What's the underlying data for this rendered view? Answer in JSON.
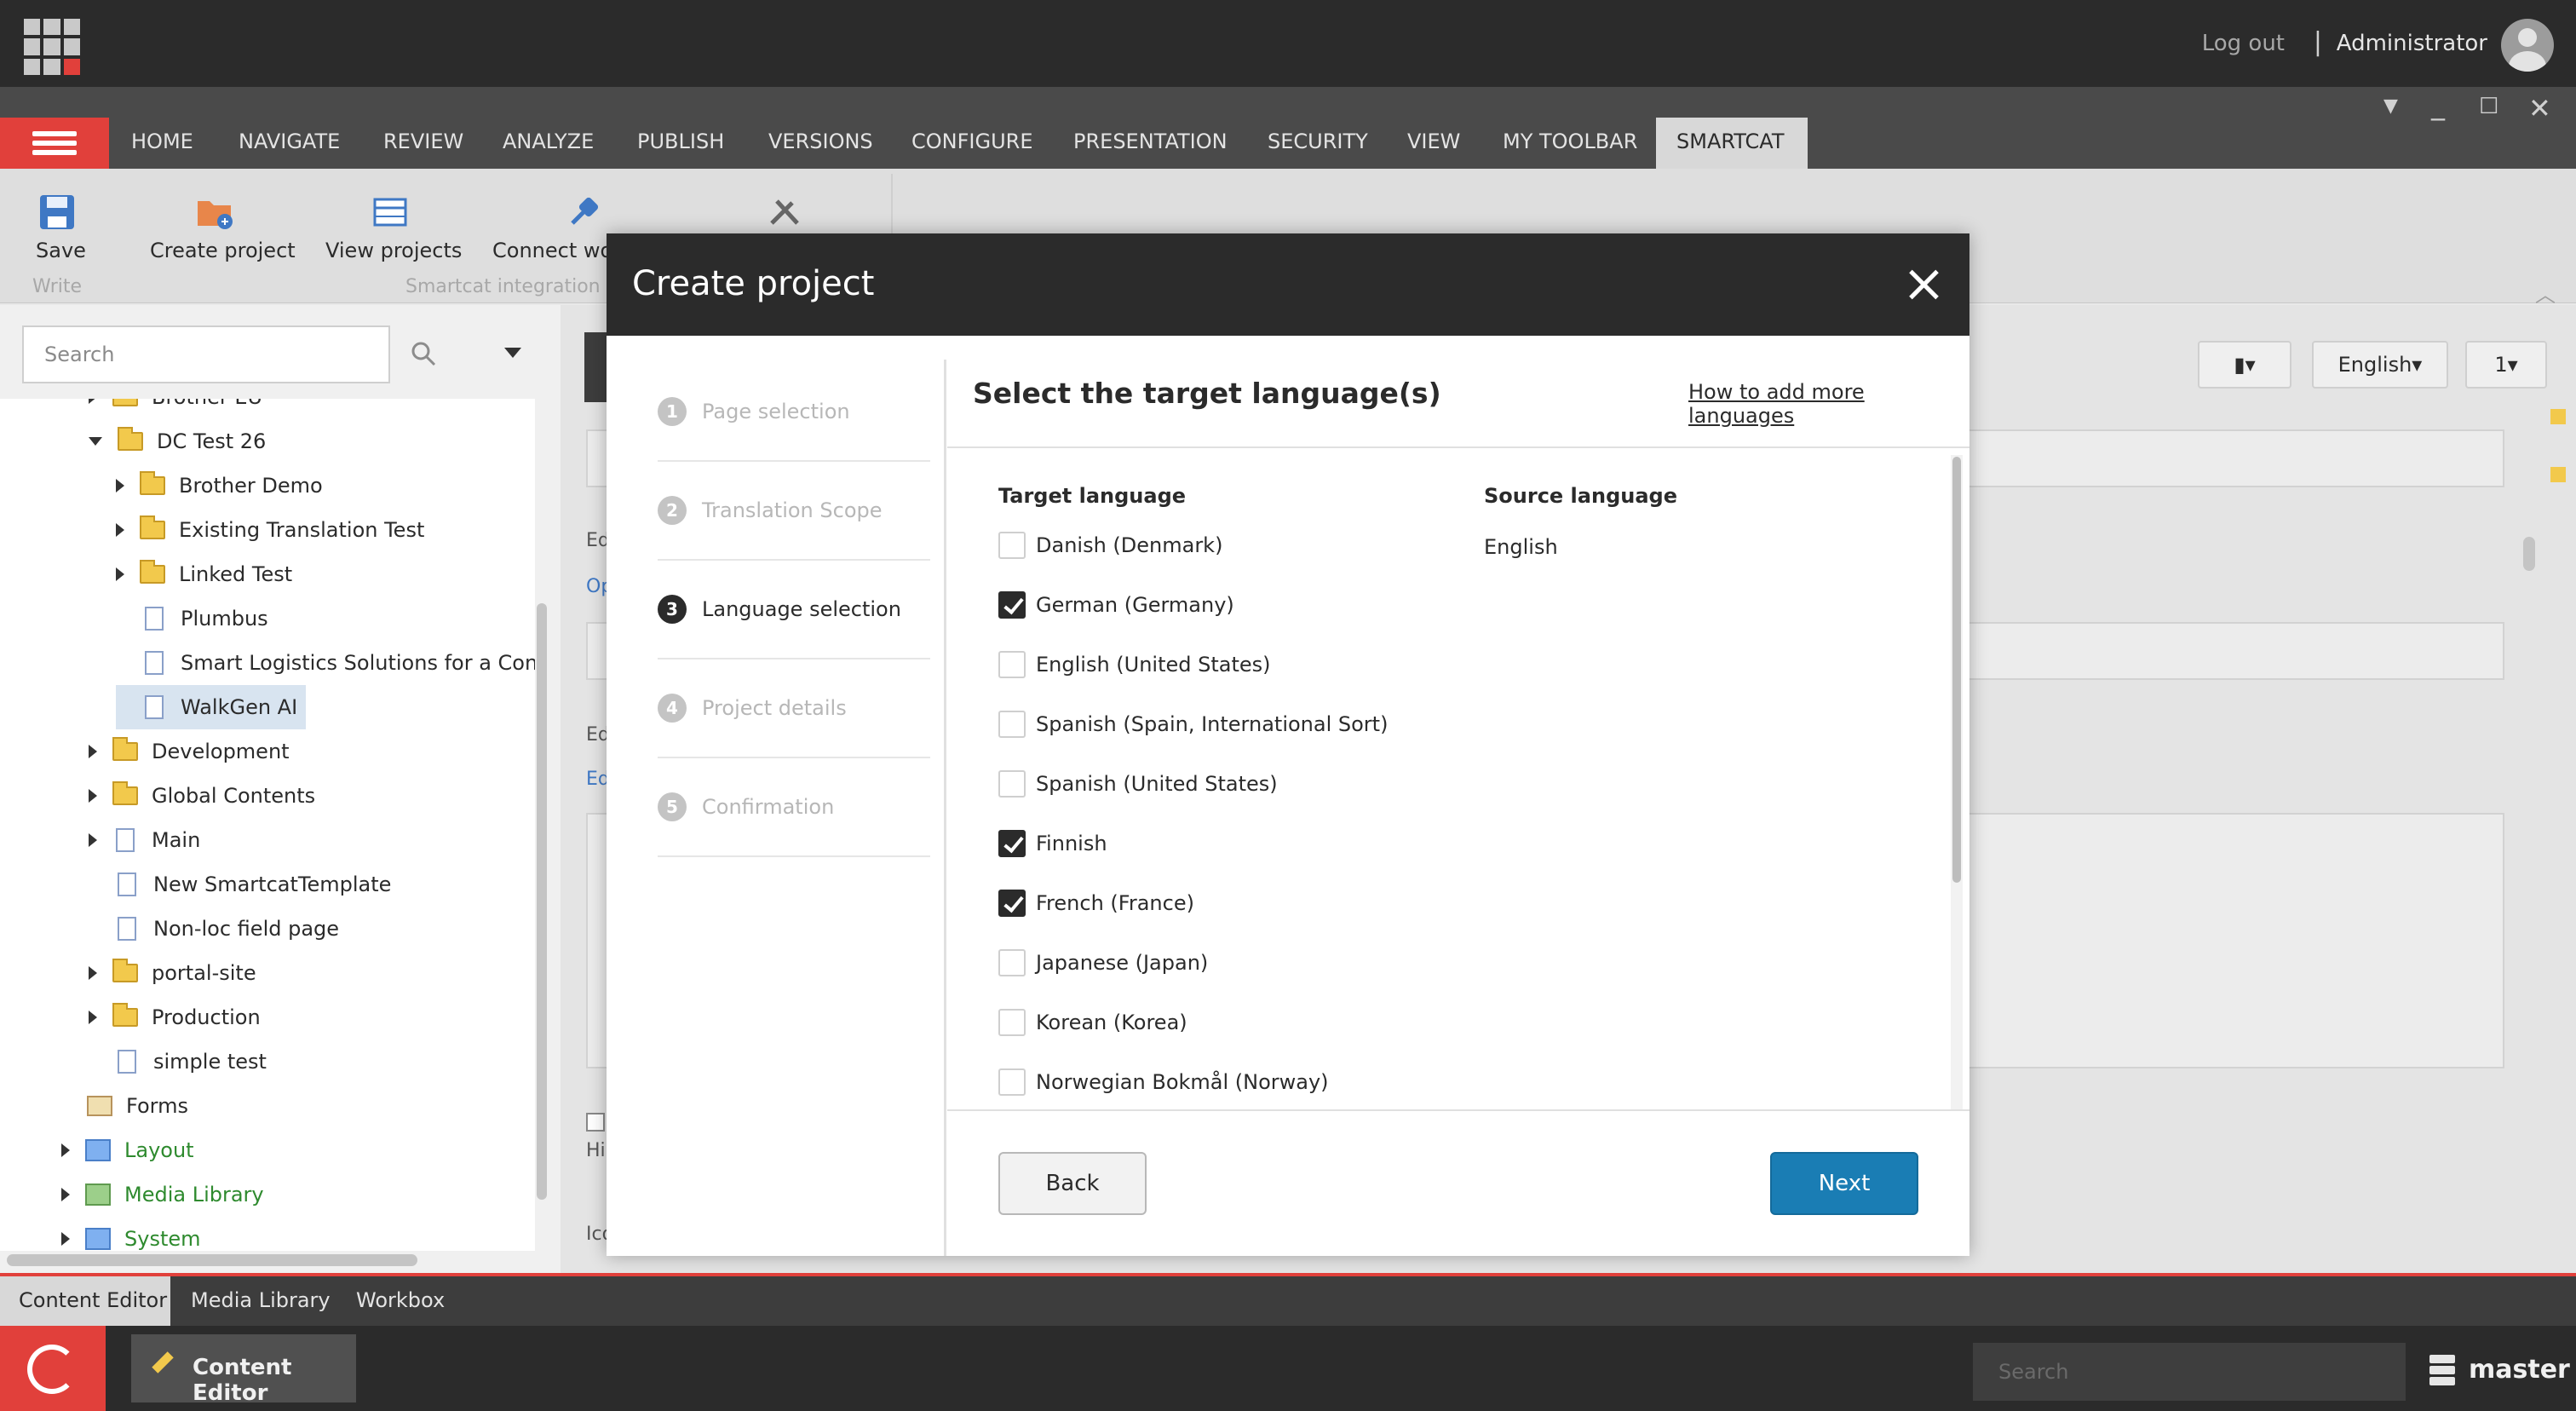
{
  "topbar": {
    "logout": "Log out",
    "separator": "|",
    "user": "Administrator"
  },
  "ribbon_tabs": [
    "HOME",
    "NAVIGATE",
    "REVIEW",
    "ANALYZE",
    "PUBLISH",
    "VERSIONS",
    "CONFIGURE",
    "PRESENTATION",
    "SECURITY",
    "VIEW",
    "MY TOOLBAR",
    "SMARTCAT"
  ],
  "active_tab": "SMARTCAT",
  "ribbon": {
    "save": "Save",
    "create_project": "Create project",
    "view_projects": "View projects",
    "connect": "Connect wo",
    "group_write": "Write",
    "group_smartcat": "Smartcat integration"
  },
  "search": {
    "placeholder": "Search"
  },
  "tree": [
    {
      "label": "Brother EU",
      "indent": 1,
      "arrow": "r",
      "icon": "folder"
    },
    {
      "label": "DC Test 26",
      "indent": 1,
      "arrow": "d",
      "icon": "folder"
    },
    {
      "label": "Brother Demo",
      "indent": 2,
      "arrow": "r",
      "icon": "folder"
    },
    {
      "label": "Existing Translation Test",
      "indent": 2,
      "arrow": "r",
      "icon": "folder"
    },
    {
      "label": "Linked Test",
      "indent": 2,
      "arrow": "r",
      "icon": "folder"
    },
    {
      "label": "Plumbus",
      "indent": 2,
      "arrow": "",
      "icon": "doc"
    },
    {
      "label": "Smart Logistics Solutions for a Con",
      "indent": 2,
      "arrow": "",
      "icon": "doc"
    },
    {
      "label": "WalkGen AI",
      "indent": 2,
      "arrow": "",
      "icon": "doc",
      "selected": true
    },
    {
      "label": "Development",
      "indent": 1,
      "arrow": "r",
      "icon": "folder"
    },
    {
      "label": "Global Contents",
      "indent": 1,
      "arrow": "r",
      "icon": "folder"
    },
    {
      "label": "Main",
      "indent": 1,
      "arrow": "r",
      "icon": "doc"
    },
    {
      "label": "New SmartcatTemplate",
      "indent": 1,
      "arrow": "",
      "icon": "doc"
    },
    {
      "label": "Non-loc field page",
      "indent": 1,
      "arrow": "",
      "icon": "doc"
    },
    {
      "label": "portal-site",
      "indent": 1,
      "arrow": "r",
      "icon": "folder"
    },
    {
      "label": "Production",
      "indent": 1,
      "arrow": "r",
      "icon": "folder"
    },
    {
      "label": "simple test",
      "indent": 1,
      "arrow": "",
      "icon": "doc"
    },
    {
      "label": "Forms",
      "indent": 0,
      "arrow": "",
      "icon": "forms"
    },
    {
      "label": "Layout",
      "indent": 0,
      "arrow": "r",
      "icon": "layout",
      "green": true
    },
    {
      "label": "Media Library",
      "indent": 0,
      "arrow": "r",
      "icon": "media",
      "green": true
    },
    {
      "label": "System",
      "indent": 0,
      "arrow": "r",
      "icon": "layout",
      "green": true
    }
  ],
  "right_controls": {
    "language": "English▾",
    "version": "1▾"
  },
  "bg_fragments": [
    "Ed",
    "Op",
    "Ed",
    "Ed",
    "Hi",
    "Ico"
  ],
  "bottom_tabs": [
    "Content Editor",
    "Media Library",
    "Workbox"
  ],
  "taskbar": {
    "content_editor": "Content Editor",
    "search_placeholder": "Search",
    "database": "master"
  },
  "dialog": {
    "title": "Create project",
    "steps": [
      {
        "num": "1",
        "label": "Page selection",
        "active": false
      },
      {
        "num": "2",
        "label": "Translation Scope",
        "active": false
      },
      {
        "num": "3",
        "label": "Language selection",
        "active": true
      },
      {
        "num": "4",
        "label": "Project details",
        "active": false
      },
      {
        "num": "5",
        "label": "Confirmation",
        "active": false
      }
    ],
    "heading": "Select the target language(s)",
    "help_link": "How to add more languages",
    "col_target": "Target language",
    "col_source": "Source language",
    "source_value": "English",
    "languages": [
      {
        "label": "Danish (Denmark)",
        "checked": false
      },
      {
        "label": "German (Germany)",
        "checked": true
      },
      {
        "label": "English (United States)",
        "checked": false
      },
      {
        "label": "Spanish (Spain, International Sort)",
        "checked": false
      },
      {
        "label": "Spanish (United States)",
        "checked": false
      },
      {
        "label": "Finnish",
        "checked": true
      },
      {
        "label": "French (France)",
        "checked": true
      },
      {
        "label": "Japanese (Japan)",
        "checked": false
      },
      {
        "label": "Korean (Korea)",
        "checked": false
      },
      {
        "label": "Norwegian Bokmål (Norway)",
        "checked": false
      }
    ],
    "back": "Back",
    "next": "Next"
  }
}
